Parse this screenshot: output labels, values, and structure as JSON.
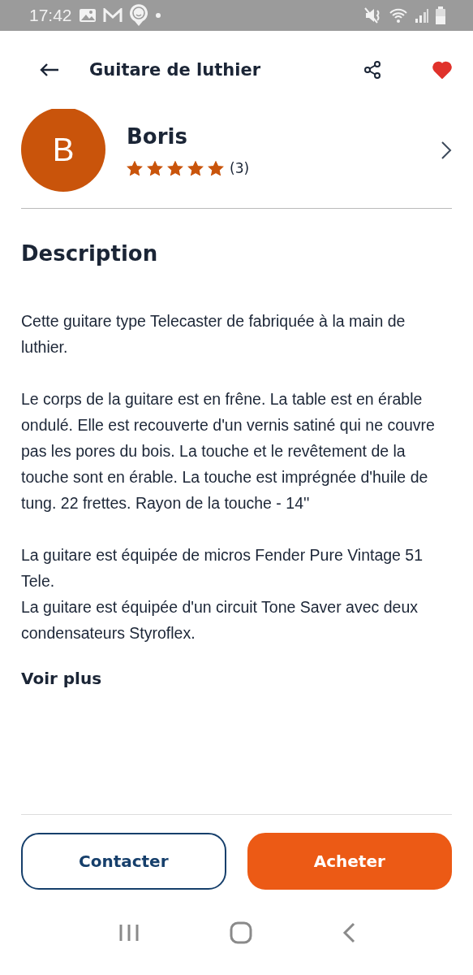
{
  "status_bar": {
    "time": "17:42"
  },
  "header": {
    "title": "Guitare de luthier",
    "favorite": true
  },
  "seller": {
    "initial": "B",
    "name": "Boris",
    "stars": 5,
    "rating_count": "(3)"
  },
  "description": {
    "heading": "Description",
    "paragraphs": [
      [
        "Cette guitare type Telecaster de fabriquée à la main de luthier."
      ],
      [
        "Le corps de la guitare est en frêne. La table est en érable ondulé. Elle est recouverte d'un vernis satiné qui ne couvre pas les pores du bois. La touche et le revêtement de la touche sont en érable. La touche est imprégnée d'huile de tung.  22 frettes.  Rayon de la touche - 14''"
      ],
      [
        "La guitare est équipée de micros Fender Pure Vintage 51 Tele.",
        "La guitare est équipée d'un circuit Tone Saver avec deux condensateurs Styroflex."
      ]
    ],
    "more_link": "Voir plus"
  },
  "actions": [
    {
      "label": "Contacter",
      "kind": "secondary"
    },
    {
      "label": "Acheter",
      "kind": "primary"
    }
  ]
}
